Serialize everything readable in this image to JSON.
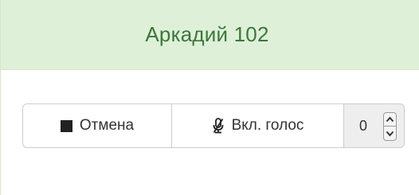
{
  "panel": {
    "title": "Аркадий 102"
  },
  "controls": {
    "cancel_label": "Отмена",
    "voice_label": "Вкл. голос",
    "number_value": "0"
  },
  "colors": {
    "heading_bg": "#dff0d8",
    "heading_text": "#3c763d",
    "border": "#cccccc"
  },
  "icons": {
    "cancel": "stop-icon",
    "voice": "microphone-muted-icon",
    "spin_up": "chevron-up-icon",
    "spin_down": "chevron-down-icon"
  }
}
